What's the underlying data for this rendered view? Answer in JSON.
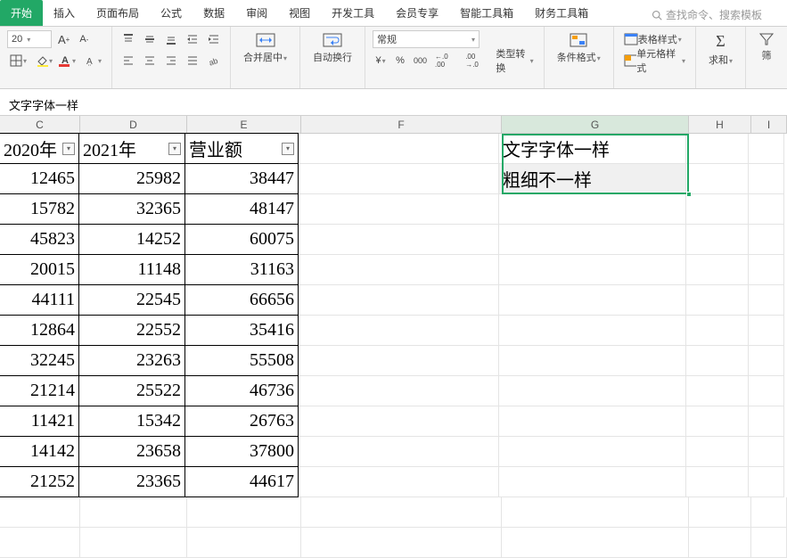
{
  "tabs": {
    "active": "开始",
    "items": [
      "插入",
      "页面布局",
      "公式",
      "数据",
      "审阅",
      "视图",
      "开发工具",
      "会员专享",
      "智能工具箱",
      "财务工具箱"
    ],
    "search_placeholder": "查找命令、搜索模板"
  },
  "ribbon": {
    "font_size": "20",
    "font_inc": "A⁺",
    "font_dec": "A⁻",
    "number_format": "常规",
    "merge_label": "合并居中",
    "wrap_label": "自动换行",
    "currency": "¥",
    "percent": "%",
    "comma": "000",
    "dec_inc": "←.0 .00",
    "dec_dec": ".00 →.0",
    "type_convert": "类型转换",
    "cond_fmt": "条件格式",
    "table_style": "表格样式",
    "cell_style": "单元格样式",
    "sum_label": "求和",
    "filter_label": "筛"
  },
  "formula_bar": {
    "value": "文字字体一样"
  },
  "columns": [
    "C",
    "D",
    "E",
    "F",
    "G",
    "H",
    "I"
  ],
  "headers": {
    "c": "2020年",
    "d": "2021年",
    "e": "营业额"
  },
  "data_rows": [
    {
      "c": "12465",
      "d": "25982",
      "e": "38447"
    },
    {
      "c": "15782",
      "d": "32365",
      "e": "48147"
    },
    {
      "c": "45823",
      "d": "14252",
      "e": "60075"
    },
    {
      "c": "20015",
      "d": "11148",
      "e": "31163"
    },
    {
      "c": "44111",
      "d": "22545",
      "e": "66656"
    },
    {
      "c": "12864",
      "d": "22552",
      "e": "35416"
    },
    {
      "c": "32245",
      "d": "23263",
      "e": "55508"
    },
    {
      "c": "21214",
      "d": "25522",
      "e": "46736"
    },
    {
      "c": "11421",
      "d": "15342",
      "e": "26763"
    },
    {
      "c": "14142",
      "d": "23658",
      "e": "37800"
    },
    {
      "c": "21252",
      "d": "23365",
      "e": "44617"
    }
  ],
  "g_cells": {
    "g1": "文字字体一样",
    "g2": "粗细不一样"
  },
  "filter_glyph": "▾"
}
